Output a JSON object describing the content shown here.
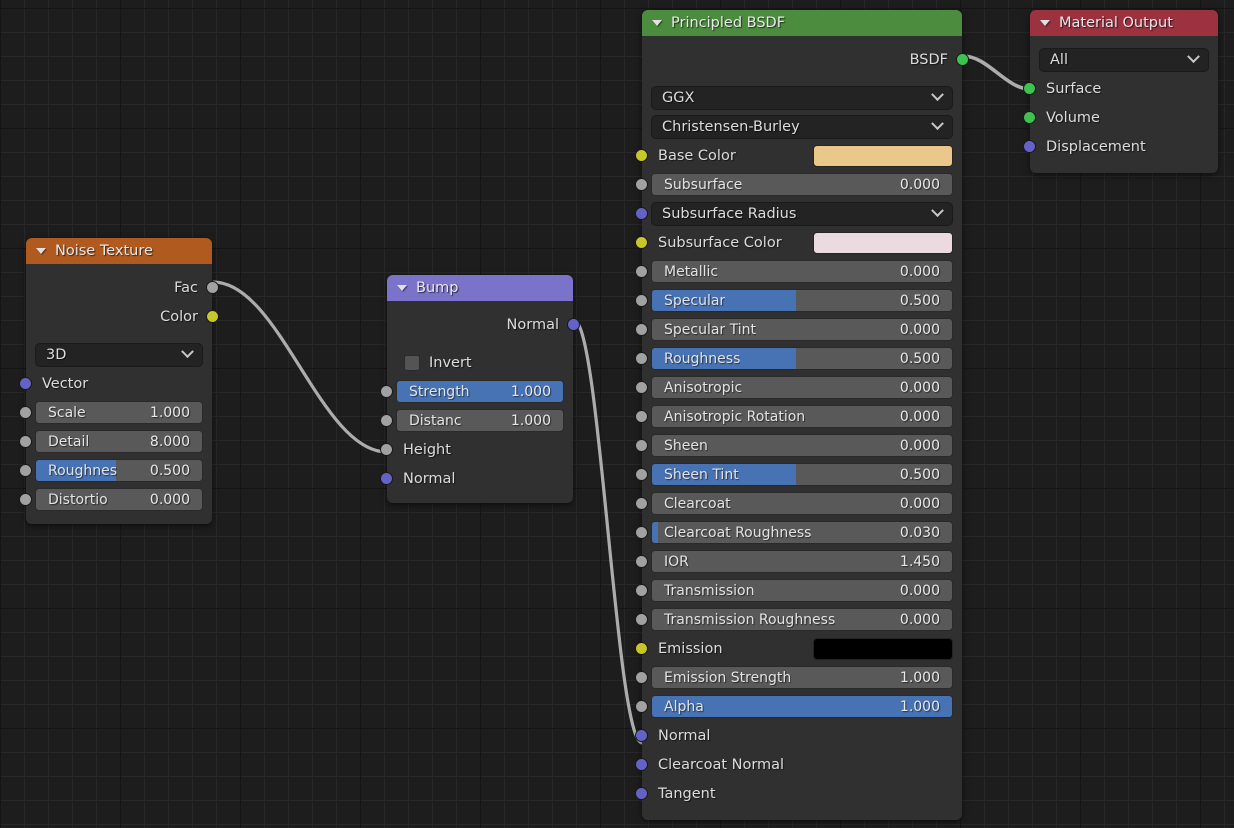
{
  "editor": {
    "name": "blender-shader-node-editor",
    "background_color": "#1d1d1d",
    "grid_minor_color": "#282828",
    "grid_major_color": "#151515"
  },
  "socket_colors": {
    "value": "#a1a1a1",
    "color": "#c7c729",
    "vector": "#6363c7",
    "shader": "#3fc14f"
  },
  "nodes": {
    "noise_texture": {
      "title": "Noise Texture",
      "header_color": "#b05a1f",
      "collapse_icon": "triangle-down-icon",
      "outputs": [
        {
          "label": "Fac",
          "socket": "value"
        },
        {
          "label": "Color",
          "socket": "color"
        }
      ],
      "dropdown": {
        "label": "dimensions",
        "value": "3D"
      },
      "inputs": [
        {
          "label": "Vector",
          "socket": "vector",
          "kind": "label"
        },
        {
          "label": "Scale",
          "socket": "value",
          "kind": "slider",
          "value": "1.000",
          "fill": 0
        },
        {
          "label": "Detail",
          "socket": "value",
          "kind": "slider",
          "value": "8.000",
          "fill": 0
        },
        {
          "label": "Roughnes",
          "socket": "value",
          "kind": "slider",
          "value": "0.500",
          "fill": 48
        },
        {
          "label": "Distortio",
          "socket": "value",
          "kind": "slider",
          "value": "0.000",
          "fill": 0
        }
      ]
    },
    "bump": {
      "title": "Bump",
      "header_color": "#7b72c9",
      "collapse_icon": "triangle-down-icon",
      "outputs": [
        {
          "label": "Normal",
          "socket": "vector"
        }
      ],
      "checkbox": {
        "label": "Invert",
        "checked": false
      },
      "inputs": [
        {
          "label": "Strength",
          "socket": "value",
          "kind": "slider",
          "value": "1.000",
          "fill": 100
        },
        {
          "label": "Distanc",
          "socket": "value",
          "kind": "slider",
          "value": "1.000",
          "fill": 0
        },
        {
          "label": "Height",
          "socket": "value",
          "kind": "label"
        },
        {
          "label": "Normal",
          "socket": "vector",
          "kind": "label"
        }
      ]
    },
    "principled_bsdf": {
      "title": "Principled BSDF",
      "header_color": "#4c8c3f",
      "collapse_icon": "triangle-down-icon",
      "outputs": [
        {
          "label": "BSDF",
          "socket": "shader"
        }
      ],
      "dropdowns": [
        {
          "label": "distribution",
          "value": "GGX"
        },
        {
          "label": "subsurface-method",
          "value": "Christensen-Burley"
        }
      ],
      "inputs": [
        {
          "label": "Base Color",
          "socket": "color",
          "kind": "color",
          "color": "#e9c88a"
        },
        {
          "label": "Subsurface",
          "socket": "value",
          "kind": "slider",
          "value": "0.000",
          "fill": 0
        },
        {
          "label": "Subsurface Radius",
          "socket": "vector",
          "kind": "dropdown"
        },
        {
          "label": "Subsurface Color",
          "socket": "color",
          "kind": "color",
          "color": "#ecdae1"
        },
        {
          "label": "Metallic",
          "socket": "value",
          "kind": "slider",
          "value": "0.000",
          "fill": 0
        },
        {
          "label": "Specular",
          "socket": "value",
          "kind": "slider",
          "value": "0.500",
          "fill": 48
        },
        {
          "label": "Specular Tint",
          "socket": "value",
          "kind": "slider",
          "value": "0.000",
          "fill": 0
        },
        {
          "label": "Roughness",
          "socket": "value",
          "kind": "slider",
          "value": "0.500",
          "fill": 48
        },
        {
          "label": "Anisotropic",
          "socket": "value",
          "kind": "slider",
          "value": "0.000",
          "fill": 0
        },
        {
          "label": "Anisotropic Rotation",
          "socket": "value",
          "kind": "slider",
          "value": "0.000",
          "fill": 0
        },
        {
          "label": "Sheen",
          "socket": "value",
          "kind": "slider",
          "value": "0.000",
          "fill": 0
        },
        {
          "label": "Sheen Tint",
          "socket": "value",
          "kind": "slider",
          "value": "0.500",
          "fill": 48
        },
        {
          "label": "Clearcoat",
          "socket": "value",
          "kind": "slider",
          "value": "0.000",
          "fill": 0
        },
        {
          "label": "Clearcoat Roughness",
          "socket": "value",
          "kind": "slider",
          "value": "0.030",
          "fill": 2
        },
        {
          "label": "IOR",
          "socket": "value",
          "kind": "slider",
          "value": "1.450",
          "fill": 0
        },
        {
          "label": "Transmission",
          "socket": "value",
          "kind": "slider",
          "value": "0.000",
          "fill": 0
        },
        {
          "label": "Transmission Roughness",
          "socket": "value",
          "kind": "slider",
          "value": "0.000",
          "fill": 0
        },
        {
          "label": "Emission",
          "socket": "color",
          "kind": "color",
          "color": "#000000"
        },
        {
          "label": "Emission Strength",
          "socket": "value",
          "kind": "slider",
          "value": "1.000",
          "fill": 0
        },
        {
          "label": "Alpha",
          "socket": "value",
          "kind": "slider",
          "value": "1.000",
          "fill": 100
        },
        {
          "label": "Normal",
          "socket": "vector",
          "kind": "label"
        },
        {
          "label": "Clearcoat Normal",
          "socket": "vector",
          "kind": "label"
        },
        {
          "label": "Tangent",
          "socket": "vector",
          "kind": "label"
        }
      ]
    },
    "material_output": {
      "title": "Material Output",
      "header_color": "#9c3140",
      "collapse_icon": "triangle-down-icon",
      "dropdown": {
        "label": "target",
        "value": "All"
      },
      "inputs": [
        {
          "label": "Surface",
          "socket": "shader"
        },
        {
          "label": "Volume",
          "socket": "shader"
        },
        {
          "label": "Displacement",
          "socket": "vector"
        }
      ]
    }
  },
  "links": [
    {
      "from": "noise_texture.Fac",
      "to": "bump.Height"
    },
    {
      "from": "bump.Normal",
      "to": "principled_bsdf.Normal"
    },
    {
      "from": "principled_bsdf.BSDF",
      "to": "material_output.Surface"
    }
  ]
}
